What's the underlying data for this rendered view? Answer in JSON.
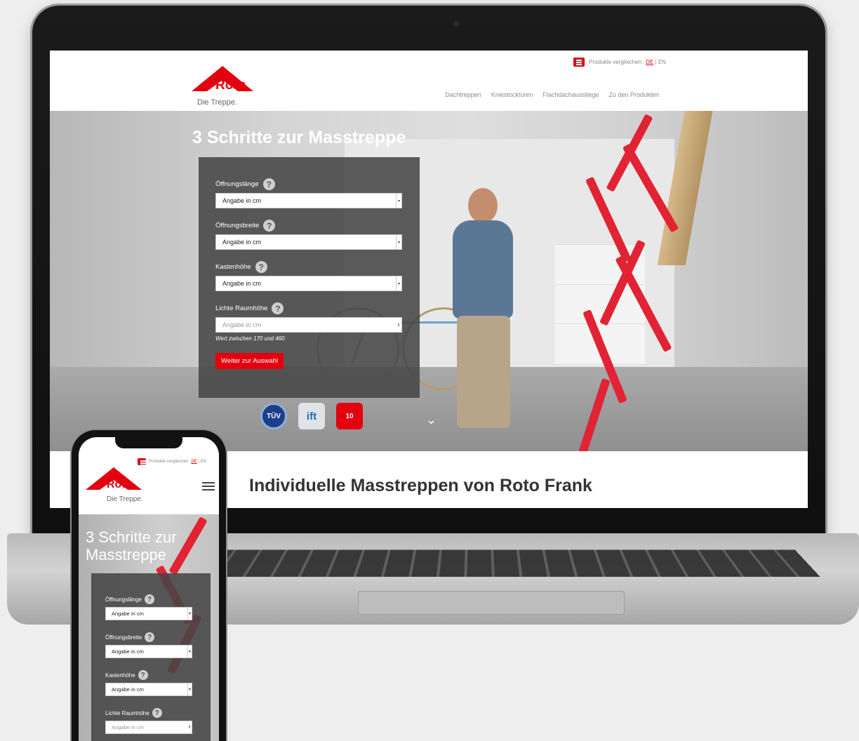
{
  "laptop": {
    "header": {
      "compare_label": "Produkte vergleichen",
      "lang_de": "DE",
      "lang_sep": "|",
      "lang_en": "EN",
      "logo_word": "Roto",
      "logo_tagline": "Die Treppe.",
      "nav": [
        "Dachtreppen",
        "Kniestocktüren",
        "Flachdachausstiege",
        "Zu den Produkten"
      ]
    },
    "hero": {
      "title": "3 Schritte zur Masstreppe",
      "fields": [
        {
          "label": "Öffnungslänge",
          "value": "Angabe in cm"
        },
        {
          "label": "Öffnungsbreite",
          "value": "Angabe in cm"
        },
        {
          "label": "Kastenhöhe",
          "value": "Angabe in cm"
        },
        {
          "label": "Lichte Raumhöhe",
          "placeholder": "Angabe in cm"
        }
      ],
      "hint": "Wert zwischen 170 und 460",
      "submit_label": "Weiter zur Auswahl",
      "badges": [
        "TÜV",
        "ift",
        "10"
      ],
      "help_glyph": "?",
      "chevron": "⌄"
    },
    "content_title": "Individuelle Masstreppen von Roto Frank"
  },
  "phone": {
    "compare_label": "Produkte vergleichen",
    "lang_de": "DE",
    "lang_sep": "|",
    "lang_en": "EN",
    "logo_word": "Roto",
    "logo_tagline": "Die Treppe.",
    "hero_title": "3 Schritte zur Masstreppe",
    "fields": [
      {
        "label": "Öffnungslänge",
        "value": "Angabe in cm"
      },
      {
        "label": "Öffnungsbreite",
        "value": "Angabe in cm"
      },
      {
        "label": "Kastenhöhe",
        "value": "Angabe in cm"
      },
      {
        "label": "Lichte Raumhöhe",
        "placeholder": "Angabe in cm"
      }
    ]
  },
  "colors": {
    "brand_red": "#e3000f",
    "panel": "#464646"
  }
}
